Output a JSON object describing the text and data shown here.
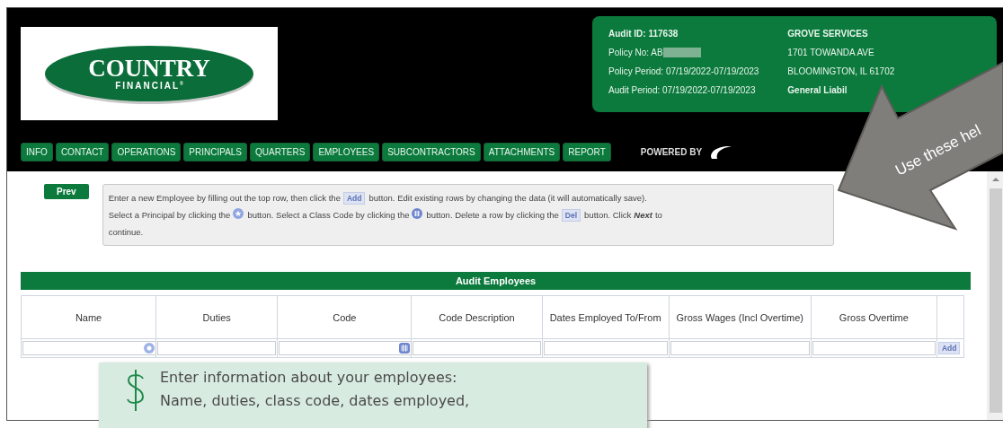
{
  "logo": {
    "name": "COUNTRY",
    "sub": "FINANCIAL",
    "mark": "®"
  },
  "audit_info": {
    "left": [
      {
        "text": "Audit ID: 117638",
        "kind": "bold"
      },
      {
        "text": "Policy No: AB",
        "kind": "redacted"
      },
      {
        "text": "Policy Period: 07/19/2022-07/19/2023",
        "kind": "plain"
      },
      {
        "text": "Audit Period: 07/19/2022-07/19/2023",
        "kind": "plain"
      }
    ],
    "right": [
      {
        "text": "GROVE SERVICES",
        "kind": "bold"
      },
      {
        "text": "1701 TOWANDA AVE",
        "kind": "plain"
      },
      {
        "text": "BLOOMINGTON, IL 61702",
        "kind": "plain"
      },
      {
        "text": "General Liabil",
        "kind": "bold"
      }
    ]
  },
  "nav": [
    "INFO",
    "CONTACT",
    "OPERATIONS",
    "PRINCIPALS",
    "QUARTERS",
    "EMPLOYEES",
    "SUBCONTRACTORS",
    "ATTACHMENTS",
    "REPORT"
  ],
  "powered_by": "POWERED BY",
  "prev_button": "Prev",
  "instructions": [
    {
      "kind": "text",
      "text": "Enter a new Employee by filling out the top row, then click the"
    },
    {
      "kind": "chip",
      "text": "Add"
    },
    {
      "kind": "text",
      "text": "button. Edit existing rows by changing the data (it will automatically save)."
    },
    {
      "kind": "break"
    },
    {
      "kind": "text",
      "text": "Select a Principal by clicking the"
    },
    {
      "kind": "star"
    },
    {
      "kind": "text",
      "text": "button. Select a Class Code by clicking the"
    },
    {
      "kind": "grid"
    },
    {
      "kind": "text",
      "text": "button. Delete a row by clicking the"
    },
    {
      "kind": "chip",
      "text": "Del"
    },
    {
      "kind": "text",
      "text": "button. Click"
    },
    {
      "kind": "emph",
      "text": "Next"
    },
    {
      "kind": "text",
      "text": "to"
    },
    {
      "kind": "break"
    },
    {
      "kind": "text",
      "text": "continue."
    }
  ],
  "section_title": "Audit Employees",
  "table": {
    "columns": [
      "Name",
      "Duties",
      "Code",
      "Code Description",
      "Dates Employed To/From",
      "Gross Wages (Incl Overtime)",
      "Gross Overtime"
    ],
    "input_row": [
      {
        "kind": "star"
      },
      {
        "kind": "plain"
      },
      {
        "kind": "grid"
      },
      {
        "kind": "plain"
      },
      {
        "kind": "plain"
      },
      {
        "kind": "plain"
      },
      {
        "kind": "plain"
      }
    ],
    "add_button": "Add"
  },
  "arrow_callout": {
    "text": "Use these hel"
  },
  "tip_callout": {
    "lines": [
      "Enter information about your employees:",
      "Name, duties, class code, dates employed,"
    ]
  }
}
